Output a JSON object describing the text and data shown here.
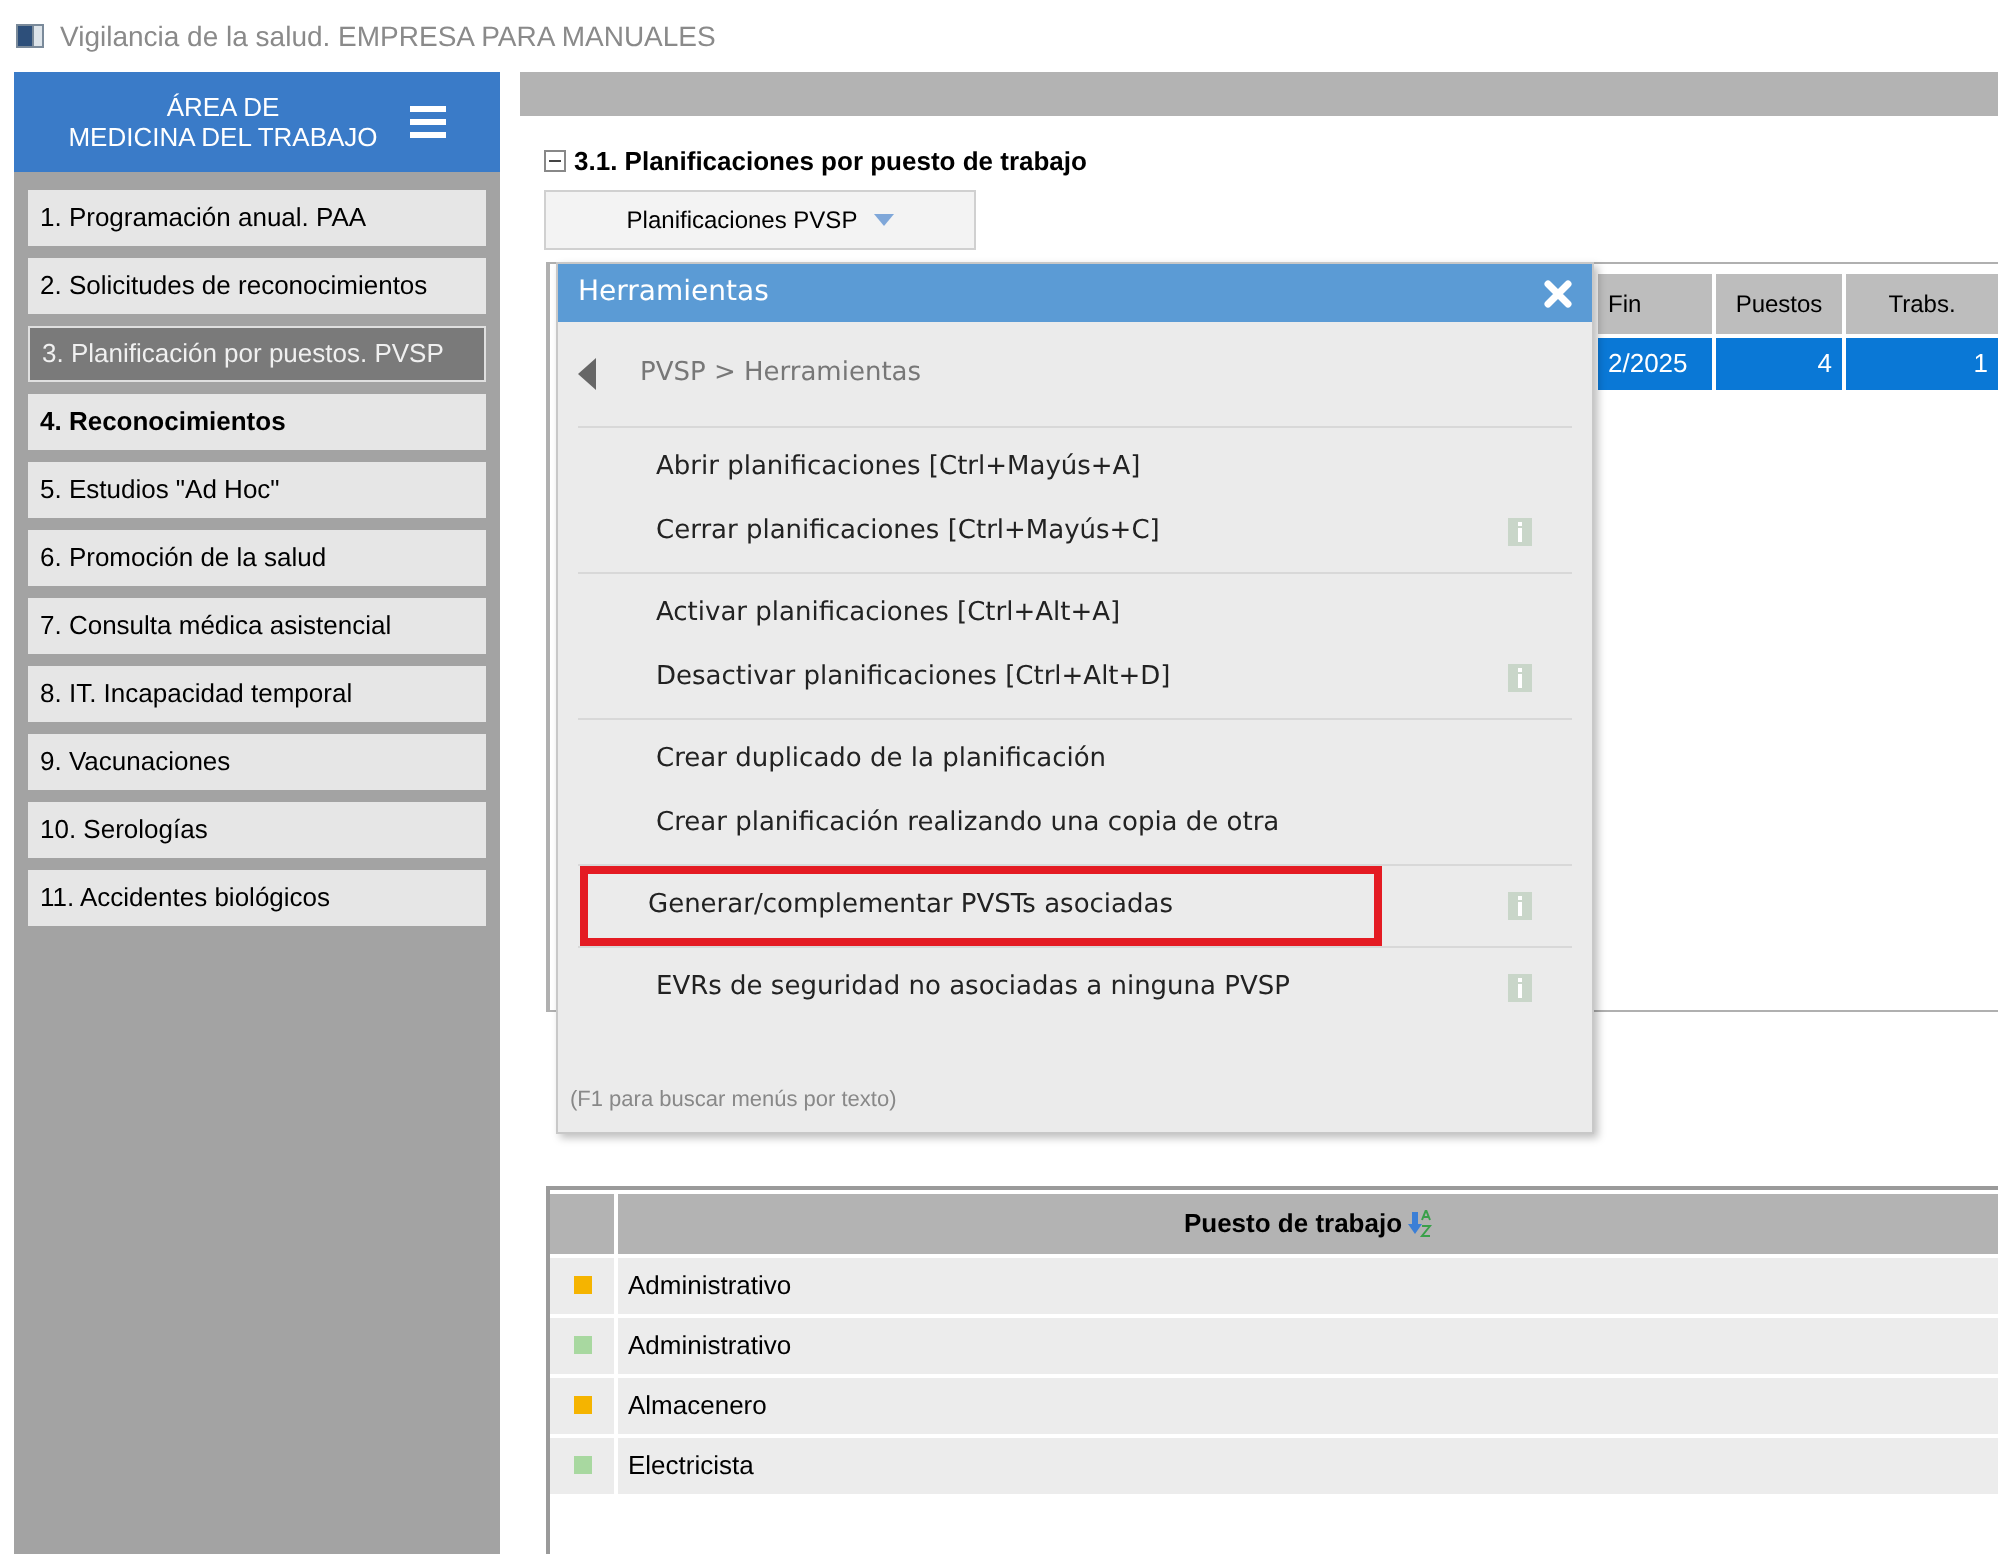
{
  "window": {
    "title": "Vigilancia de la salud.  EMPRESA PARA MANUALES"
  },
  "sidebar": {
    "header": "ÁREA DE\nMEDICINA DEL TRABAJO",
    "items": [
      {
        "label": "1. Programación anual. PAA",
        "selected": false,
        "bold": false
      },
      {
        "label": "2. Solicitudes de reconocimientos",
        "selected": false,
        "bold": false
      },
      {
        "label": "3. Planificación por puestos. PVSP",
        "selected": true,
        "bold": false
      },
      {
        "label": "4. Reconocimientos",
        "selected": false,
        "bold": true
      },
      {
        "label": "5. Estudios \"Ad Hoc\"",
        "selected": false,
        "bold": false
      },
      {
        "label": "6. Promoción de la salud",
        "selected": false,
        "bold": false
      },
      {
        "label": "7. Consulta médica asistencial",
        "selected": false,
        "bold": false
      },
      {
        "label": "8. IT. Incapacidad temporal",
        "selected": false,
        "bold": false
      },
      {
        "label": "9. Vacunaciones",
        "selected": false,
        "bold": false
      },
      {
        "label": "10. Serologías",
        "selected": false,
        "bold": false
      },
      {
        "label": "11. Accidentes biológicos",
        "selected": false,
        "bold": false
      }
    ]
  },
  "section": {
    "title": "3.1. Planificaciones por puesto de trabajo",
    "expanded": true,
    "dropdown": {
      "label": "Planificaciones PVSP"
    }
  },
  "plans_table": {
    "columns": [
      "Fin",
      "Puestos",
      "Trabs."
    ],
    "rows": [
      {
        "cells": [
          "2/2025",
          "4",
          "1"
        ],
        "selected": true
      }
    ]
  },
  "menu": {
    "title": "Herramientas",
    "breadcrumb": "PVSP > Herramientas",
    "sections": [
      [
        {
          "label": "Abrir planificaciones  [Ctrl+Mayús+A]",
          "info": false,
          "highlighted": false
        },
        {
          "label": "Cerrar planificaciones  [Ctrl+Mayús+C]",
          "info": true,
          "highlighted": false
        }
      ],
      [
        {
          "label": "Activar planificaciones  [Ctrl+Alt+A]",
          "info": false,
          "highlighted": false
        },
        {
          "label": "Desactivar planificaciones  [Ctrl+Alt+D]",
          "info": true,
          "highlighted": false
        }
      ],
      [
        {
          "label": "Crear duplicado de la planificación",
          "info": false,
          "highlighted": false
        },
        {
          "label": "Crear planificación realizando una copia de otra",
          "info": false,
          "highlighted": false
        }
      ],
      [
        {
          "label": "Generar/complementar PVSTs asociadas",
          "info": true,
          "highlighted": true
        }
      ],
      [
        {
          "label": "EVRs de seguridad no asociadas a ninguna PVSP",
          "info": true,
          "highlighted": false
        }
      ]
    ],
    "hint": "(F1 para buscar menús por texto)"
  },
  "jobs_table": {
    "column": "Puesto de trabajo",
    "rows": [
      {
        "label": "Administrativo",
        "color": "#f5b400"
      },
      {
        "label": "Administrativo",
        "color": "#a8d8a0"
      },
      {
        "label": "Almacenero",
        "color": "#f5b400"
      },
      {
        "label": "Electricista",
        "color": "#a8d8a0"
      }
    ]
  }
}
